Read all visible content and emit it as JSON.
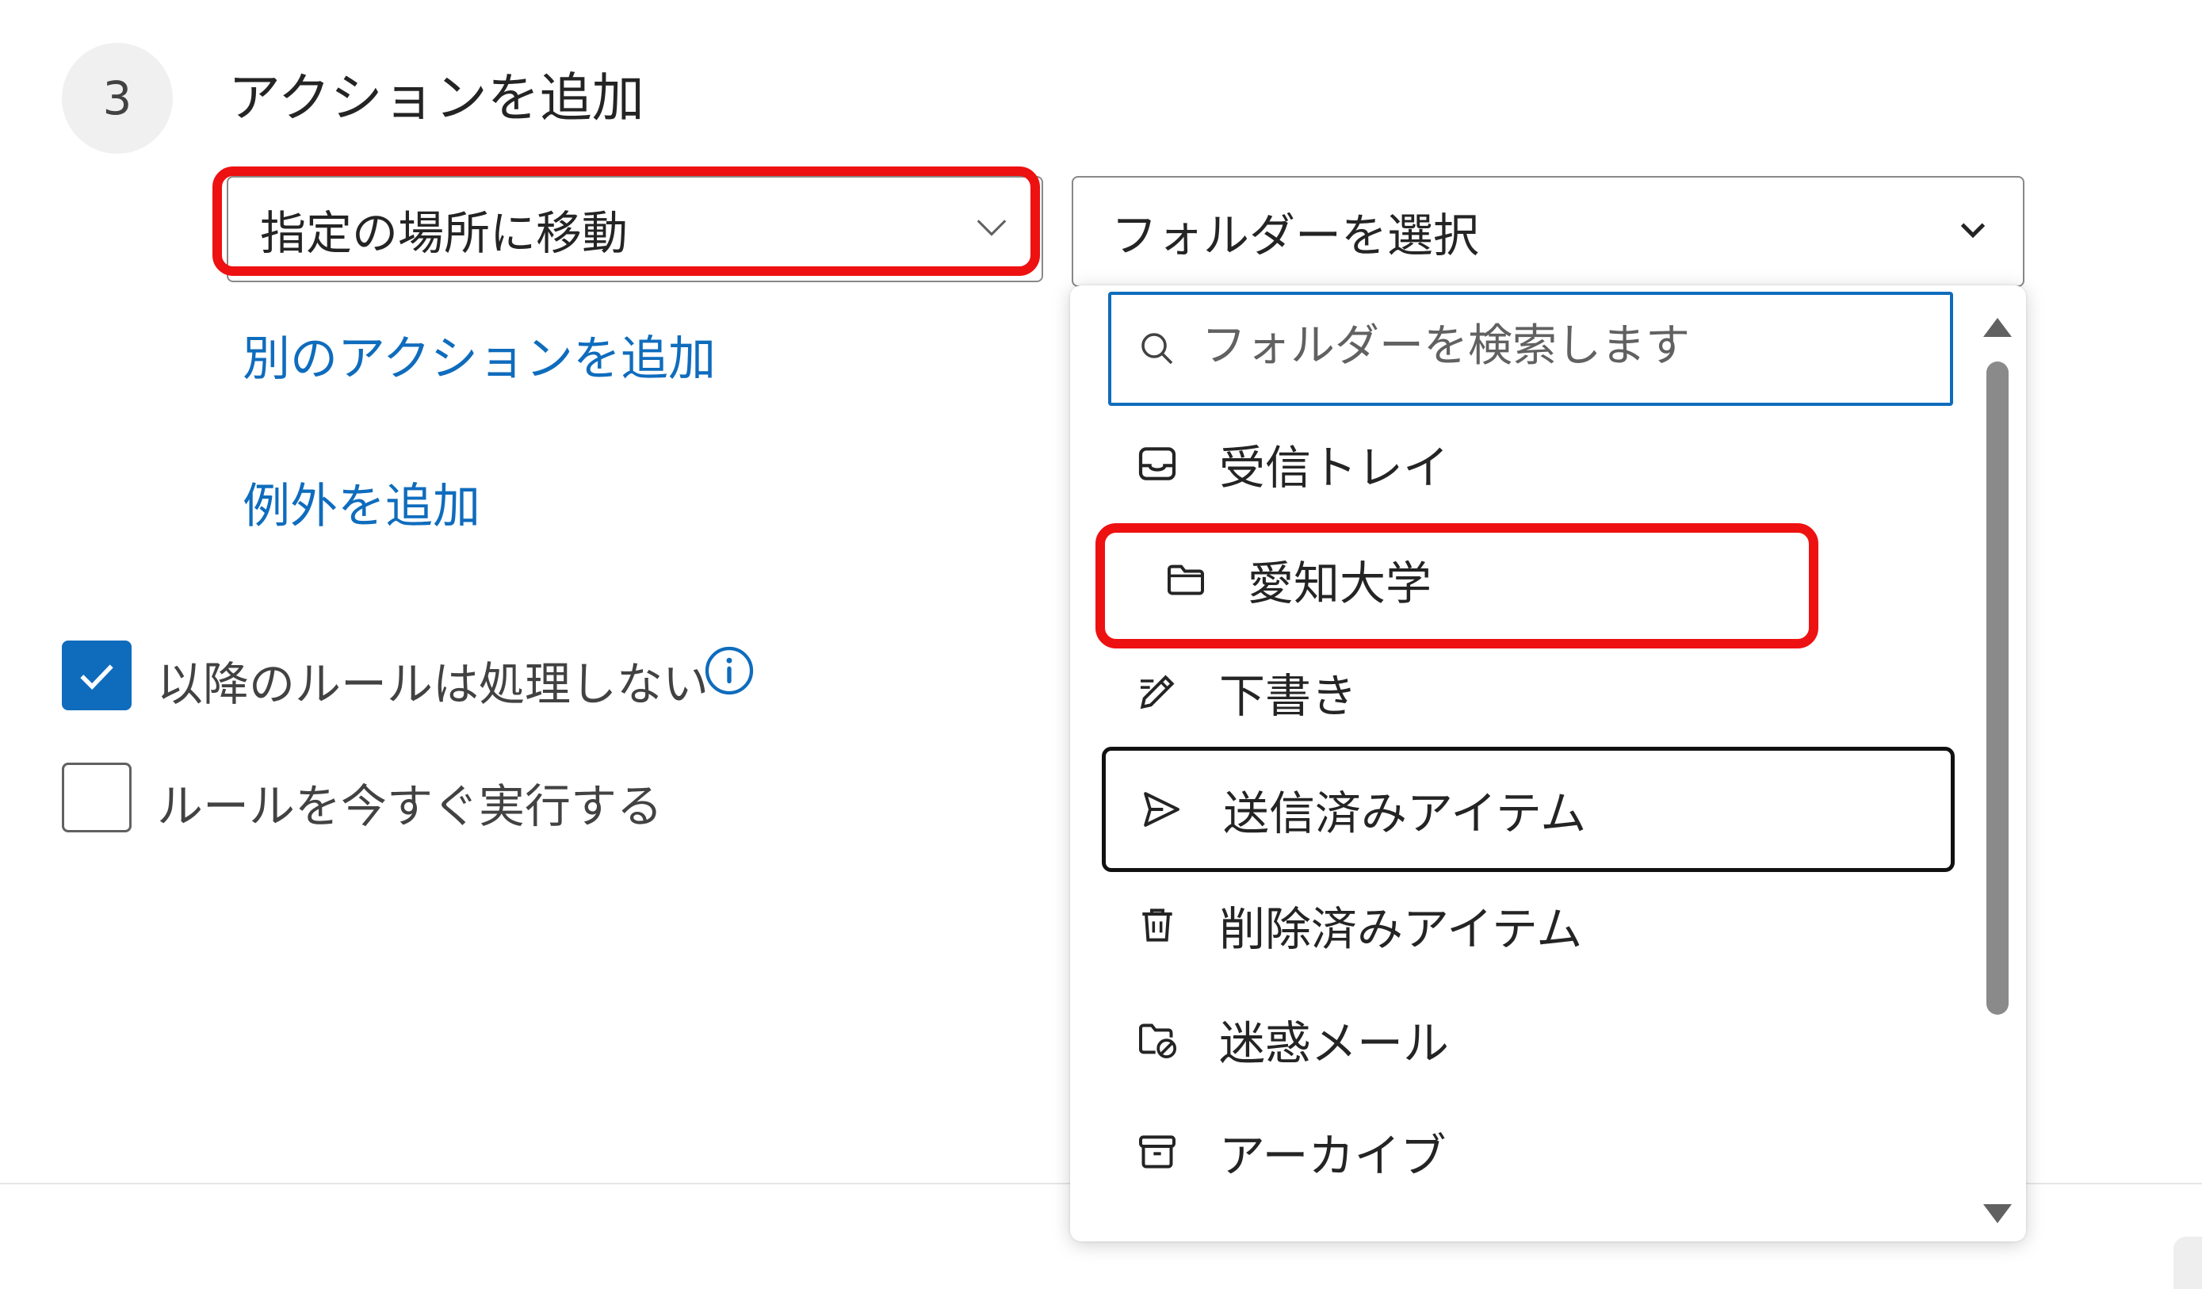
{
  "step": {
    "number": "3",
    "title": "アクションを追加"
  },
  "action_dropdown": {
    "value": "指定の場所に移動"
  },
  "folder_dropdown": {
    "value": "フォルダーを選択"
  },
  "links": {
    "add_another_action": "別のアクションを追加",
    "add_exception": "例外を追加"
  },
  "options": {
    "stop_processing": {
      "label": "以降のルールは処理しない",
      "checked": true
    },
    "run_now": {
      "label": "ルールを今すぐ実行する",
      "checked": false
    }
  },
  "folder_menu": {
    "search_placeholder": "フォルダーを検索します",
    "items": [
      {
        "label": "受信トレイ",
        "icon": "inbox-icon"
      },
      {
        "label": "愛知大学",
        "icon": "folder-icon"
      },
      {
        "label": "下書き",
        "icon": "pencil-icon"
      },
      {
        "label": "送信済みアイテム",
        "icon": "send-icon"
      },
      {
        "label": "削除済みアイテム",
        "icon": "trash-icon"
      },
      {
        "label": "迷惑メール",
        "icon": "junk-folder-icon"
      },
      {
        "label": "アーカイブ",
        "icon": "archive-icon"
      }
    ]
  },
  "colors": {
    "accent": "#0f6cbd",
    "highlight_red": "#ee1111"
  }
}
